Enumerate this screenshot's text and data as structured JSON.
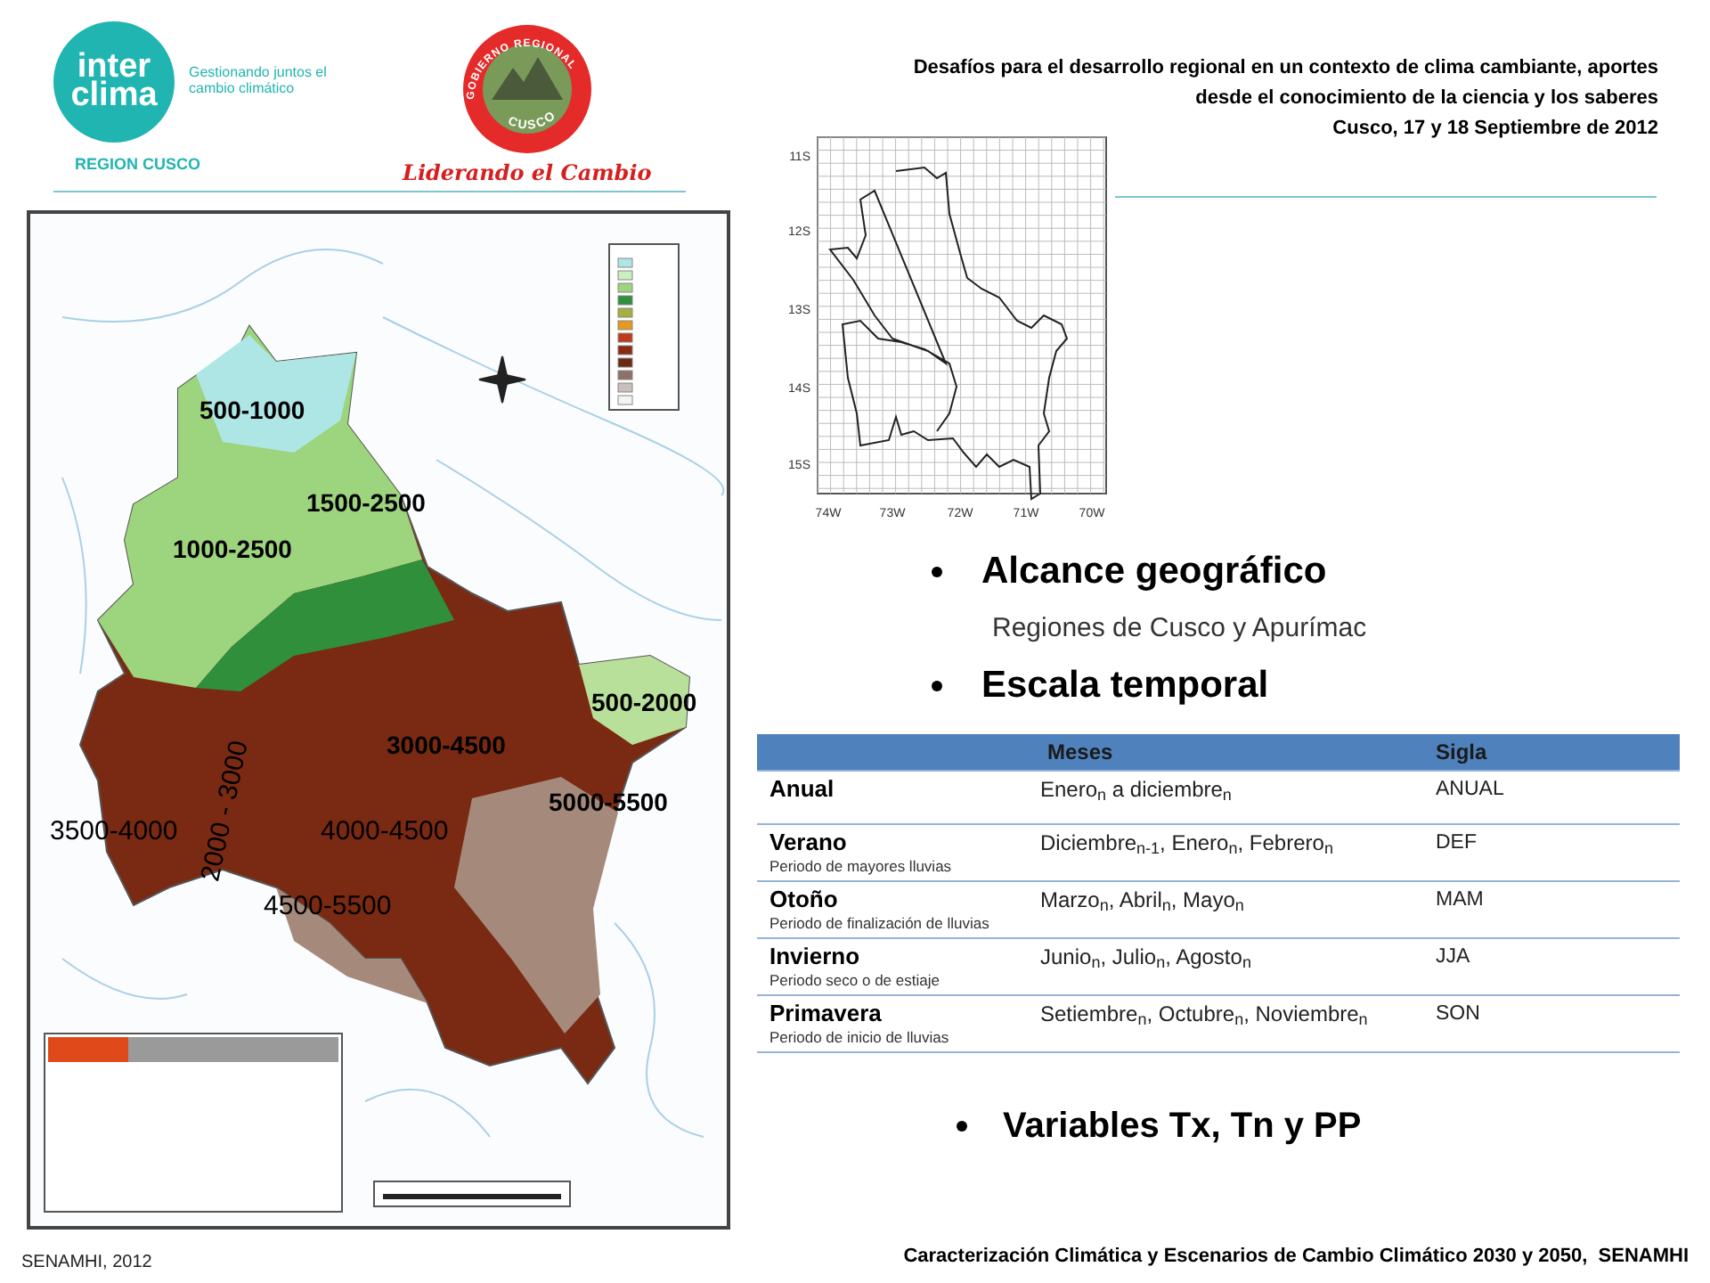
{
  "header": {
    "logo_interclima": {
      "line_1": "inter",
      "line_2": "clima",
      "tagline": "Gestionando juntos el cambio climático",
      "region": "REGION CUSCO"
    },
    "logo_gobierno": {
      "ring_top": "GOBIERNO REGIONAL",
      "ring_bottom": "CUSCO",
      "motto": "Liderando el Cambio"
    },
    "title_lines": [
      "Desafíos para el desarrollo regional en un contexto de clima cambiante, aportes",
      "desde el conocimiento de la ciencia y los saberes",
      "Cusco, 17 y 18 Septiembre de 2012"
    ]
  },
  "relief_map": {
    "labels": [
      {
        "text": "500-1000",
        "bold": true
      },
      {
        "text": "1500-2500",
        "bold": true
      },
      {
        "text": "1000-2500",
        "bold": true
      },
      {
        "text": "500-2000",
        "bold": true
      },
      {
        "text": "3000-4500",
        "bold": true
      },
      {
        "text": "5000-5500",
        "bold": true
      },
      {
        "text": "3500-4000",
        "bold": false
      },
      {
        "text": "4000-4500",
        "bold": false
      },
      {
        "text": "4500-5500",
        "bold": false
      },
      {
        "text": "2000 - 3000",
        "bold": false
      }
    ]
  },
  "grid_map": {
    "y_labels": [
      "11S",
      "12S",
      "13S",
      "14S",
      "15S"
    ],
    "x_labels": [
      "74W",
      "73W",
      "72W",
      "71W",
      "70W"
    ]
  },
  "bullets": [
    {
      "text": "Alcance geográfico",
      "subtext": "Regiones de Cusco y Apurímac"
    },
    {
      "text": "Escala temporal"
    }
  ],
  "table": {
    "columns": [
      "",
      "Meses",
      "Sigla"
    ],
    "rows": [
      {
        "season": "Anual",
        "note": "",
        "months": "Enero$_{n}$ a diciembre$_{n}$",
        "code": "ANUAL"
      },
      {
        "season": "Verano",
        "note": "Periodo de mayores lluvias",
        "months": "Diciembre$_{n-1}$, Enero$_{n}$, Febrero$_{n}$",
        "code": "DEF"
      },
      {
        "season": "Otoño",
        "note": "Periodo de finalización de lluvias",
        "months": "Marzo$_{n}$, Abril$_{n}$, Mayo$_{n}$",
        "code": "MAM"
      },
      {
        "season": "Invierno",
        "note": "Periodo seco o de estiaje",
        "months": "Junio$_{n}$, Julio$_{n}$, Agosto$_{n}$",
        "code": "JJA"
      },
      {
        "season": "Primavera",
        "note": "Periodo de inicio de lluvias",
        "months": "Setiembre$_{n}$, Octubre$_{n}$, Noviembre$_{n}$",
        "code": "SON"
      }
    ]
  },
  "bottom_bullet": "Variables Tx, Tn y PP",
  "footer": {
    "source": "SENAMHI, 2012",
    "title": "Caracterización Climática y Escenarios de Cambio Climático 2030 y 2050,  SENAMHI"
  }
}
